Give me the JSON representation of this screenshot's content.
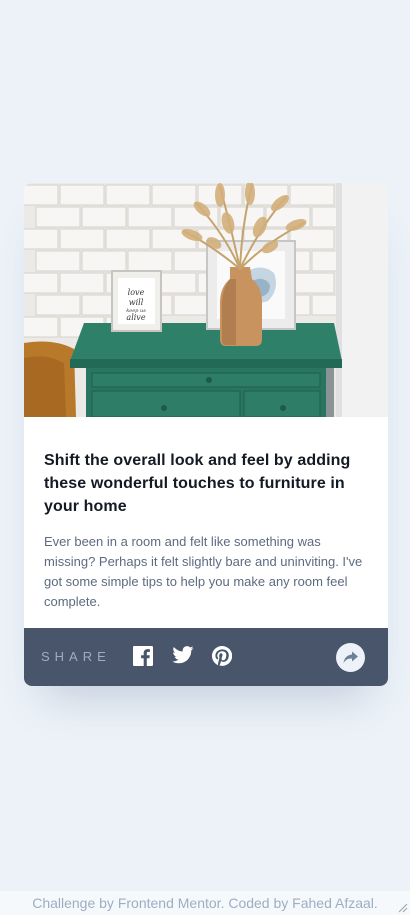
{
  "article": {
    "image": "drawers",
    "title": "Shift the overall look and feel by adding these wonderful touches to furniture in your home",
    "description": "Ever been in a room and felt like something was missing? Perhaps it felt slightly bare and uninviting. I've got some simple tips to help you make any room feel complete."
  },
  "share": {
    "label": "SHARE",
    "icons": [
      "facebook-icon",
      "twitter-icon",
      "pinterest-icon",
      "share-icon"
    ]
  },
  "attribution": {
    "prefix": "Challenge by ",
    "frontend_mentor": "Frontend Mentor",
    "middle": ". Coded by ",
    "author": "Fahed Afzaal",
    "suffix": "."
  },
  "colors": {
    "background": "#ecf2f8",
    "card": "#ffffff",
    "share_bar": "#48556a",
    "title": "#141a24",
    "text": "#5d6b80",
    "muted": "#9daec2",
    "drawer_green": "#2b7a65"
  }
}
